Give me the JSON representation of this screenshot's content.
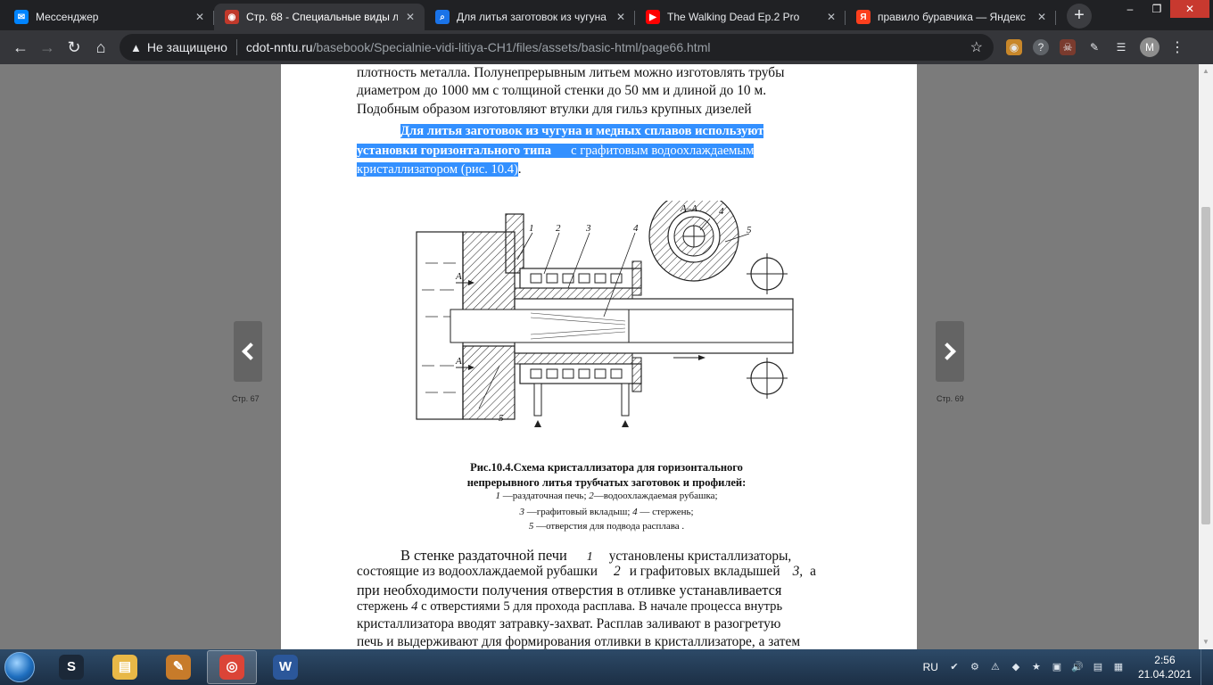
{
  "tabs": [
    {
      "title": "Мессенджер",
      "icon": "messenger-icon",
      "color": "#0084ff",
      "glyph": "✉",
      "active": false
    },
    {
      "title": "Стр. 68 - Специальные виды л",
      "icon": "book-icon",
      "color": "#c0392b",
      "glyph": "◉",
      "active": true
    },
    {
      "title": "Для литья заготовок из чугуна",
      "icon": "search-icon",
      "color": "#1a73e8",
      "glyph": "⌕",
      "active": false
    },
    {
      "title": "The Walking Dead Ep.2 Pro",
      "icon": "youtube-icon",
      "color": "#ff0000",
      "glyph": "▶",
      "active": false
    },
    {
      "title": "правило буравчика — Яндекс",
      "icon": "yandex-icon",
      "color": "#fc3f1d",
      "glyph": "Я",
      "active": false
    }
  ],
  "toolbar": {
    "security_label": "Не защищено",
    "url_host": "cdot-nntu.ru",
    "url_path": "/basebook/Specialnie-vidi-litiya-CH1/files/assets/basic-html/page66.html",
    "avatar_letter": "M"
  },
  "viewer": {
    "prev_label": "Стр. 67",
    "next_label": "Стр. 69"
  },
  "page": {
    "para1": [
      "плотность металла. Полунепрерывным литьем можно изготовлять трубы",
      "диаметром до 1000 мм с толщиной стенки до 50 мм и длиной до 10 м.",
      "Подобным образом изготовляют втулки для гильз крупных дизелей"
    ],
    "selected1": "Для литья заготовок из чугуна и медных сплавов используют",
    "selected2a": "установки горизонтального типа",
    "selected2b": "с графитовым водоохлаждаемым",
    "selected3": "кристаллизатором (рис. 10.4)",
    "selected3_tail": ".",
    "figure_labels": {
      "n1": "1",
      "n2": "2",
      "n3": "3",
      "n4": "4",
      "n5": "5",
      "section": "А–А",
      "sec4": "4",
      "sec5": "5",
      "a_top": "А",
      "a_bot": "А"
    },
    "caption_title1": "Рис.10.4.Схема кристаллизатора для горизонтального",
    "caption_title2": "непрерывного литья трубчатых заготовок и профилей:",
    "legend1_n1": "1",
    "legend1_t1": " —раздаточная печь;  ",
    "legend1_n2": "2",
    "legend1_t2": "—водоохлаждаемая рубашка;",
    "legend2_n1": "3",
    "legend2_t1": " —графитовый вкладыш;  ",
    "legend2_n2": "4",
    "legend2_t2": " — стержень;",
    "legend3_n1": "5",
    "legend3_t1": " —отверстия для подвода расплава  .",
    "para2_l1a": "В стенке раздаточной печи",
    "para2_l1n": "1",
    "para2_l1b": "установлены кристаллизаторы,",
    "para2_l2a": "состоящие из водоохлаждаемой рубашки",
    "para2_l2n": "2",
    "para2_l2b": "и графитовых вкладышей",
    "para2_l2n2": "3,",
    "para2_l2c": "а",
    "para2_l3": "при необходимости получения отверстия в отливке устанавливается",
    "para2_l4a": "стержень ",
    "para2_l4n": "4",
    "para2_l4b": " с отверстиями 5 для прохода расплава. В начале процесса внутрь",
    "para2_l5": "кристаллизатора вводят затравку-захват. Расплав заливают в разогретую",
    "para2_l6": "печь и выдерживают для формирования отливки в кристаллизаторе, а затем"
  },
  "taskbar": {
    "apps": [
      {
        "name": "steam",
        "icon": "steam-icon",
        "glyph": "S",
        "color": "#1b2838",
        "active": false
      },
      {
        "name": "explorer",
        "icon": "folder-icon",
        "glyph": "▤",
        "color": "#e8b847",
        "active": false
      },
      {
        "name": "paint",
        "icon": "palette-icon",
        "glyph": "✎",
        "color": "#c77b2a",
        "active": false
      },
      {
        "name": "chrome",
        "icon": "chrome-icon",
        "glyph": "◎",
        "color": "#db4437",
        "active": true
      },
      {
        "name": "word",
        "icon": "word-icon",
        "glyph": "W",
        "color": "#2b579a",
        "active": false
      }
    ],
    "lang": "RU",
    "time": "2:56",
    "date": "21.04.2021"
  }
}
